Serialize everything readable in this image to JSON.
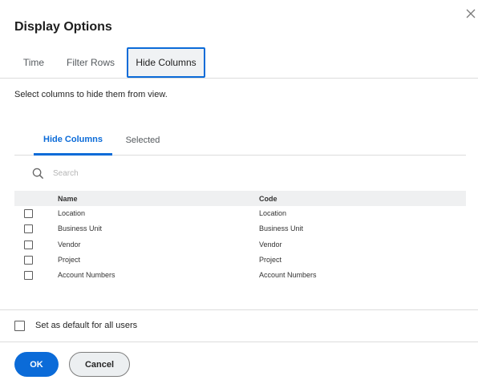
{
  "dialog": {
    "title": "Display Options",
    "close_icon": "close-icon"
  },
  "top_tabs": [
    {
      "label": "Time"
    },
    {
      "label": "Filter Rows"
    },
    {
      "label": "Hide Columns",
      "active": true
    }
  ],
  "instructions": "Select columns to hide them from view.",
  "sub_tabs": [
    {
      "label": "Hide Columns",
      "active": true
    },
    {
      "label": "Selected"
    }
  ],
  "search": {
    "placeholder": "Search",
    "value": "",
    "icon": "search-icon"
  },
  "table": {
    "columns": [
      "Name",
      "Code"
    ],
    "rows": [
      {
        "name": "Location",
        "code": "Location",
        "checked": false
      },
      {
        "name": "Business Unit",
        "code": "Business Unit",
        "checked": false
      },
      {
        "name": "Vendor",
        "code": "Vendor",
        "checked": false
      },
      {
        "name": "Project",
        "code": "Project",
        "checked": false
      },
      {
        "name": "Account Numbers",
        "code": "Account Numbers",
        "checked": false
      }
    ]
  },
  "default_option": {
    "label": "Set as default for all users",
    "checked": false
  },
  "footer": {
    "ok_label": "OK",
    "cancel_label": "Cancel"
  },
  "colors": {
    "accent": "#0b6bd8",
    "divider": "#dcdcdc",
    "header_bg": "#eff0f1"
  }
}
